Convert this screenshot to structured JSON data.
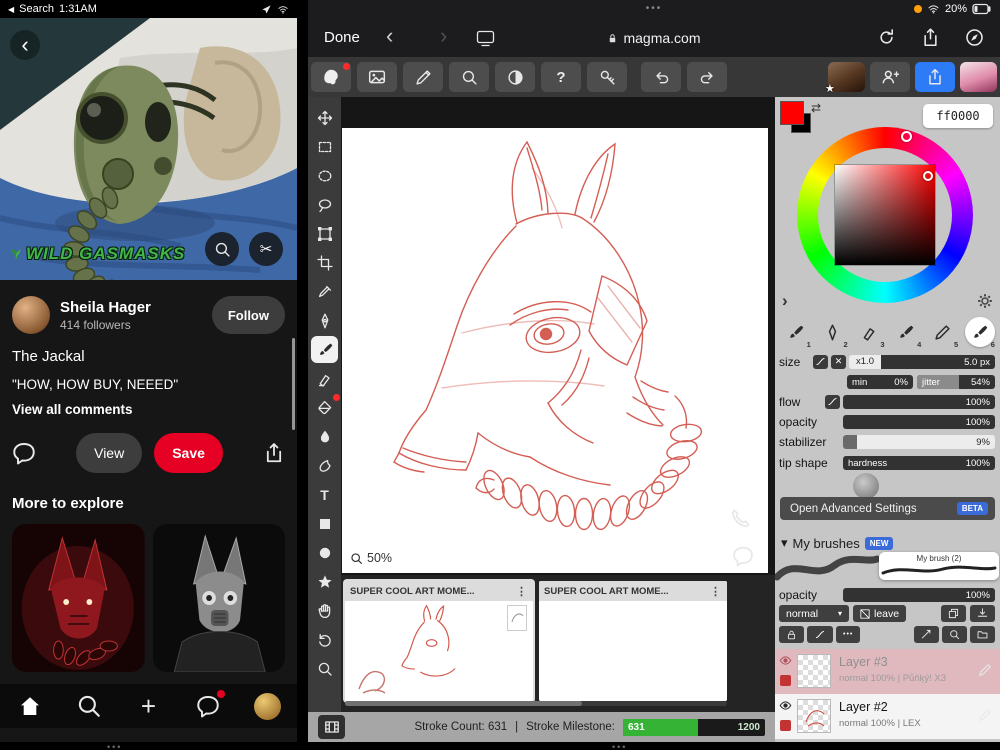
{
  "glyphs": {
    "ellipsis": "•••",
    "kebab": "⋮",
    "back": "‹",
    "forward": "›",
    "plus": "+",
    "caret": "▾",
    "chevron": "›",
    "swap": "⇄",
    "x": "✕",
    "scissors": "✂",
    "back_triangle": "◀",
    "question": "?",
    "text_tool": "T",
    "divider": "|"
  },
  "status": {
    "left": {
      "back_label": "Search",
      "time": "1:31AM"
    },
    "right": {
      "battery": "20%"
    }
  },
  "pinterest": {
    "watermark": "WILD GASMASKS",
    "author": {
      "name": "Sheila Hager",
      "followers": "414 followers",
      "follow": "Follow"
    },
    "pin": {
      "title": "The Jackal",
      "quote": "\"HOW, HOW BUY, NEEED\"",
      "view_comments": "View all comments"
    },
    "actions": {
      "view": "View",
      "save": "Save"
    },
    "explore": {
      "heading": "More to explore"
    }
  },
  "safari": {
    "done": "Done",
    "url": "magma.com"
  },
  "magma": {
    "color": {
      "hex": "ff0000",
      "primary": "#ff0000",
      "secondary": "#000000"
    },
    "brushes": {
      "numbers": [
        "1",
        "2",
        "3",
        "4",
        "5",
        "6"
      ]
    },
    "params": {
      "size": {
        "label": "size",
        "mult": "x1.0",
        "value": "5.0 px"
      },
      "min": {
        "label": "min",
        "value": "0%"
      },
      "jitter": {
        "label": "jitter",
        "value": "54%"
      },
      "flow": {
        "label": "flow",
        "value": "100%"
      },
      "opacity": {
        "label": "opacity",
        "value": "100%"
      },
      "stabilizer": {
        "label": "stabilizer",
        "value": "9%"
      },
      "tip_shape": {
        "label": "tip shape"
      },
      "hardness": {
        "label": "hardness",
        "value": "100%"
      }
    },
    "advanced": {
      "label": "Open Advanced Settings",
      "badge": "BETA"
    },
    "my_brushes": {
      "heading": "My brushes",
      "badge": "NEW",
      "brush_name": "My brush (2)"
    },
    "layer_controls": {
      "opacity_label": "opacity",
      "opacity_value": "100%",
      "blend_mode": "normal",
      "leave": "leave"
    },
    "layers": [
      {
        "name": "Layer #3",
        "meta": "normal 100% | Půňķý! X3"
      },
      {
        "name": "Layer #2",
        "meta": "normal 100% | LEX"
      }
    ],
    "canvas": {
      "zoom": "50%"
    },
    "projects": [
      {
        "title": "SUPER COOL ART MOME..."
      },
      {
        "title": "SUPER COOL ART MOME..."
      }
    ],
    "statusbar": {
      "stroke_count": "Stroke Count: 631",
      "divider": "|",
      "milestone_label": "Stroke Milestone:",
      "progress_current": "631",
      "progress_max": "1200"
    }
  }
}
